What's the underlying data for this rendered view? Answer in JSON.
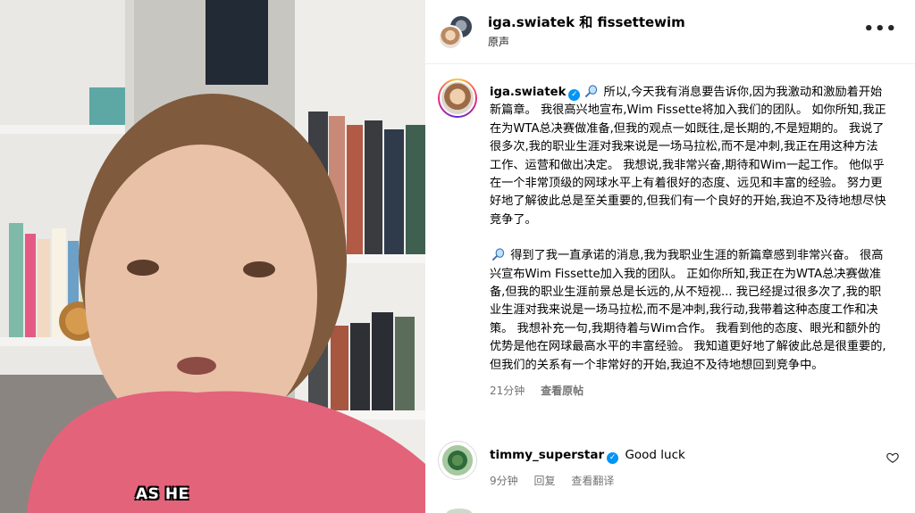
{
  "header": {
    "names": "iga.swiatek 和 fissettewim",
    "subtitle": "原声",
    "more_label": "•••"
  },
  "video": {
    "caption": "AS HE"
  },
  "post": {
    "username": "iga.swiatek",
    "paragraph1": "所以,今天我有消息要告诉你,因为我激动和激励着开始新篇章。 我很高兴地宣布,Wim Fissette将加入我们的团队。 如你所知,我正在为WTA总决赛做准备,但我的观点一如既往,是长期的,不是短期的。 我说了很多次,我的职业生涯对我来说是一场马拉松,而不是冲刺,我正在用这种方法工作、运营和做出决定。 我想说,我非常兴奋,期待和Wim一起工作。 他似乎在一个非常顶级的网球水平上有着很好的态度、远见和丰富的经验。 努力更好地了解彼此总是至关重要的,但我们有一个良好的开始,我迫不及待地想尽快竞争了。",
    "paragraph2": "得到了我一直承诺的消息,我为我职业生涯的新篇章感到非常兴奋。 很高兴宣布Wim Fissette加入我的团队。 正如你所知,我正在为WTA总决赛做准备,但我的职业生涯前景总是长远的,从不短视... 我已经提过很多次了,我的职业生涯对我来说是一场马拉松,而不是冲刺,我行动,我带着这种态度工作和决策。 我想补充一句,我期待着与Wim合作。 我看到他的态度、眼光和额外的优势是他在网球最高水平的丰富经验。 我知道更好地了解彼此总是很重要的,但我们的关系有一个非常好的开始,我迫不及待地想回到竞争中。",
    "time": "21分钟",
    "see_original": "查看原帖"
  },
  "comment": {
    "username": "timmy_superstar",
    "text": "Good luck",
    "time": "9分钟",
    "reply": "回复",
    "see_translation": "查看翻译"
  },
  "colors": {
    "verified": "#0095f6",
    "muted": "#737373",
    "caption_fill": "#ffffff"
  }
}
